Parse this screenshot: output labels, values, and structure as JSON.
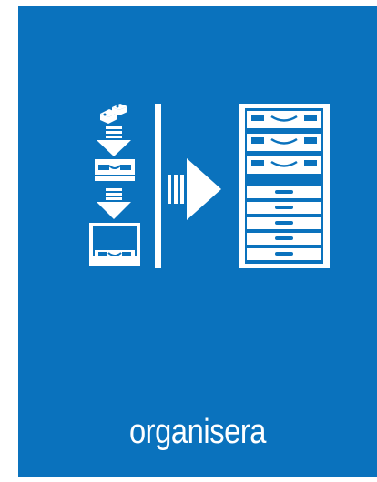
{
  "sign": {
    "caption": "organisera",
    "icon": "organise-boxes-into-cabinet-icon",
    "colors": {
      "background": "#0a72bd",
      "foreground": "#ffffff"
    }
  }
}
